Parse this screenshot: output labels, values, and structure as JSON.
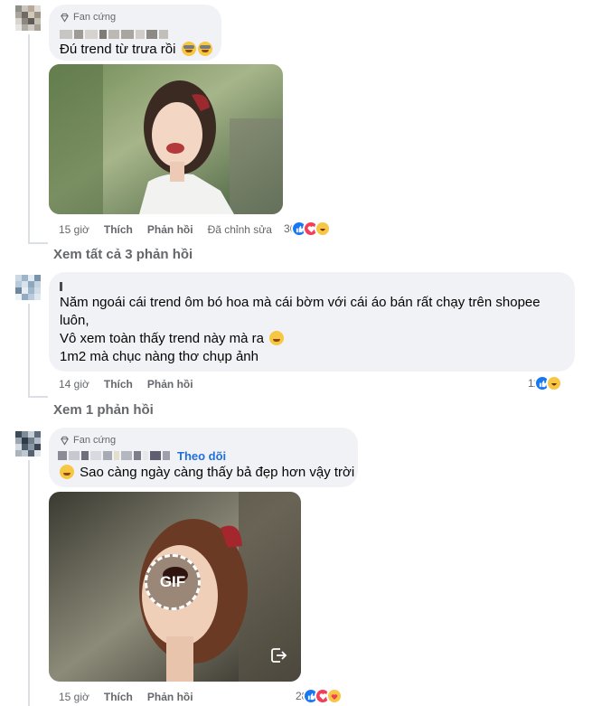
{
  "comments": [
    {
      "badge": "Fan cứng",
      "text_lines": [
        "Đú trend từ trưa rồi"
      ],
      "time": "15 giờ",
      "like": "Thích",
      "reply": "Phản hồi",
      "edited": "Đã chỉnh sửa",
      "reaction_count": "36",
      "reactions": [
        "like-icon",
        "love-icon",
        "haha-icon"
      ],
      "view_replies": "Xem tất cả 3 phản hồi"
    },
    {
      "text_lines": [
        "Năm ngoái cái trend ôm bó hoa mà cái bờm với cái áo bán rất chạy trên shopee",
        "luôn,",
        "Vô xem toàn thấy trend này mà ra",
        "1m2 mà chục nàng thơ chụp ảnh"
      ],
      "time": "14 giờ",
      "like": "Thích",
      "reply": "Phản hồi",
      "reaction_count": "11",
      "reactions": [
        "like-icon",
        "haha-icon"
      ],
      "view_replies": "Xem 1 phản hồi"
    },
    {
      "badge": "Fan cứng",
      "follow": "Theo dõi",
      "text_lines": [
        "Sao càng ngày càng thấy bả đẹp hơn vậy trời"
      ],
      "gif_label": "GIF",
      "time": "15 giờ",
      "like": "Thích",
      "reply": "Phản hồi",
      "reaction_count": "28",
      "reactions": [
        "like-icon",
        "love-icon",
        "care-icon"
      ]
    }
  ],
  "colors": {
    "bubble": "#f0f2f5",
    "meta_text": "#65676b",
    "link_blue": "#216fdb",
    "like_blue": "#1877f2",
    "love_red": "#f33e58",
    "haha_yellow": "#f7c744"
  }
}
